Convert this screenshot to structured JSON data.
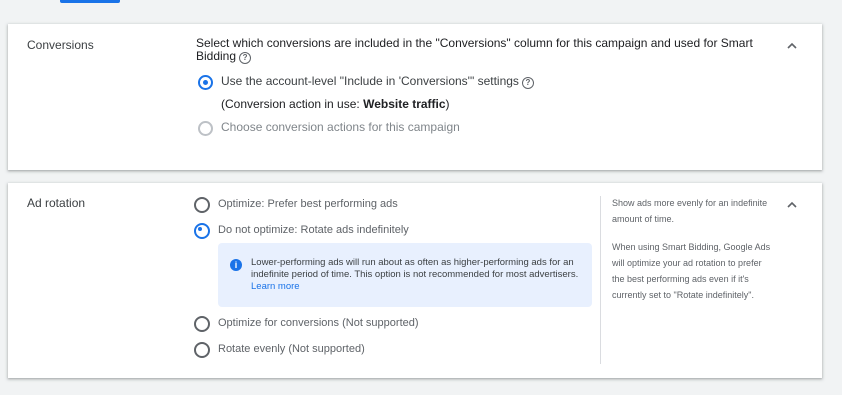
{
  "conversions": {
    "title": "Conversions",
    "description": "Select which conversions are included in the \"Conversions\" column for this campaign and used for Smart Bidding",
    "options": [
      {
        "label": "Use the account-level \"Include in 'Conversions'\" settings",
        "checked": true,
        "disabled": false
      },
      {
        "label": "Choose conversion actions for this campaign",
        "checked": false,
        "disabled": true
      }
    ],
    "note_prefix": "(Conversion action in use: ",
    "note_value": "Website traffic",
    "note_suffix": ")"
  },
  "ad_rotation": {
    "title": "Ad rotation",
    "options": [
      {
        "label": "Optimize: Prefer best performing ads",
        "checked": false
      },
      {
        "label": "Do not optimize: Rotate ads indefinitely",
        "checked": true
      },
      {
        "label": "Optimize for conversions (Not supported)",
        "checked": false
      },
      {
        "label": "Rotate evenly (Not supported)",
        "checked": false
      }
    ],
    "info_text": "Lower-performing ads will run about as often as higher-performing ads for an indefinite period of time. This option is not recommended for most advertisers.",
    "info_link": "Learn more",
    "side_para1": "Show ads more evenly for an indefinite amount of time.",
    "side_para2": "When using Smart Bidding, Google Ads will optimize your ad rotation to prefer the best performing ads even if it's currently set to \"Rotate indefinitely\"."
  },
  "icons": {
    "help": "help-circle-icon",
    "info": "info-icon",
    "collapse": "chevron-up-icon"
  },
  "colors": {
    "accent": "#1a73e8",
    "info_bg": "#e8f0fe"
  }
}
